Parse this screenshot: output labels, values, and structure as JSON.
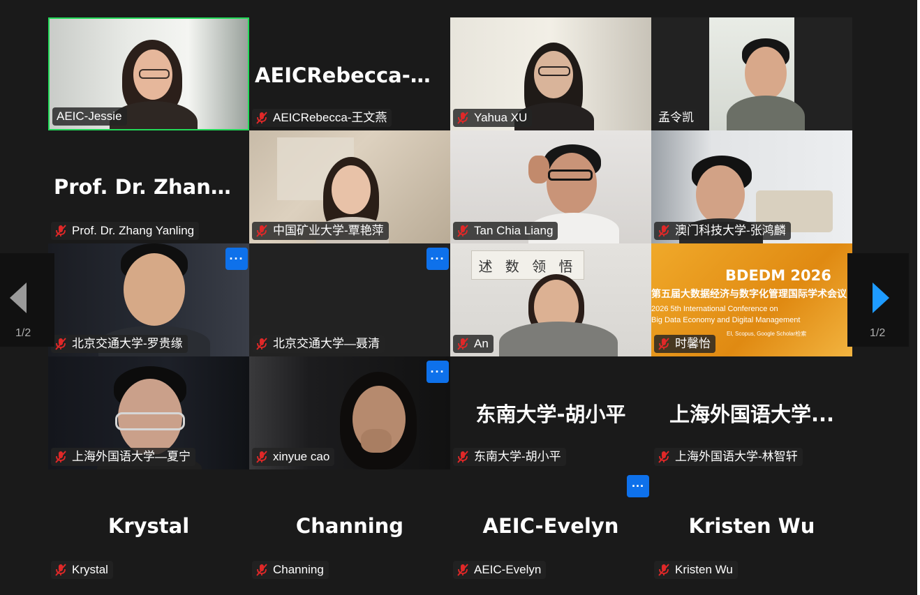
{
  "pagination": {
    "left_label": "1/2",
    "right_label": "1/2"
  },
  "more_label": "···",
  "tiles": [
    {
      "name": "AEIC-Jessie",
      "big": "",
      "muted": false
    },
    {
      "name": "AEICRebecca-王文燕",
      "big": "AEICRebecca-王...",
      "muted": true
    },
    {
      "name": "Yahua XU",
      "big": "",
      "muted": true
    },
    {
      "name": "孟令凯",
      "big": "",
      "muted": false
    },
    {
      "name": "Prof. Dr. Zhang Yanling",
      "big": "Prof. Dr. Zhang...",
      "muted": true
    },
    {
      "name": "中国矿业大学-覃艳萍",
      "big": "",
      "muted": true
    },
    {
      "name": "Tan Chia Liang",
      "big": "",
      "muted": true
    },
    {
      "name": "澳门科技大学-张鸿麟",
      "big": "",
      "muted": true
    },
    {
      "name": "北京交通大学-罗贵缘",
      "big": "",
      "muted": true
    },
    {
      "name": "北京交通大学—聂清",
      "big": "",
      "muted": true
    },
    {
      "name": "An",
      "big": "",
      "muted": true
    },
    {
      "name": "时馨怡",
      "big": "",
      "muted": true
    },
    {
      "name": "上海外国语大学—夏宁",
      "big": "",
      "muted": true
    },
    {
      "name": "xinyue cao",
      "big": "",
      "muted": true
    },
    {
      "name": "东南大学-胡小平",
      "big": "东南大学-胡小平",
      "muted": true
    },
    {
      "name": "上海外国语大学-林智轩",
      "big": "上海外国语大学...",
      "muted": true
    },
    {
      "name": "Krystal",
      "big": "Krystal",
      "muted": true
    },
    {
      "name": "Channing",
      "big": "Channing",
      "muted": true
    },
    {
      "name": "AEIC-Evelyn",
      "big": "AEIC-Evelyn",
      "muted": true
    },
    {
      "name": "Kristen Wu",
      "big": "Kristen Wu",
      "muted": true
    }
  ],
  "poster": {
    "title": "BDEDM 2026",
    "line1": "第五届大数据经济与数字化管理国际学术会议",
    "line2": "2026 5th International Conference on",
    "line3": "Big Data Economy and Digital Management",
    "line4": "EI, Scopus, Google Scholar检索"
  },
  "calligraphy": "述 数 领 悟",
  "colors": {
    "active_border": "#23d959",
    "more_button": "#0e71eb",
    "mute_red": "#e02828",
    "poster_orange": "#e99a1c"
  }
}
